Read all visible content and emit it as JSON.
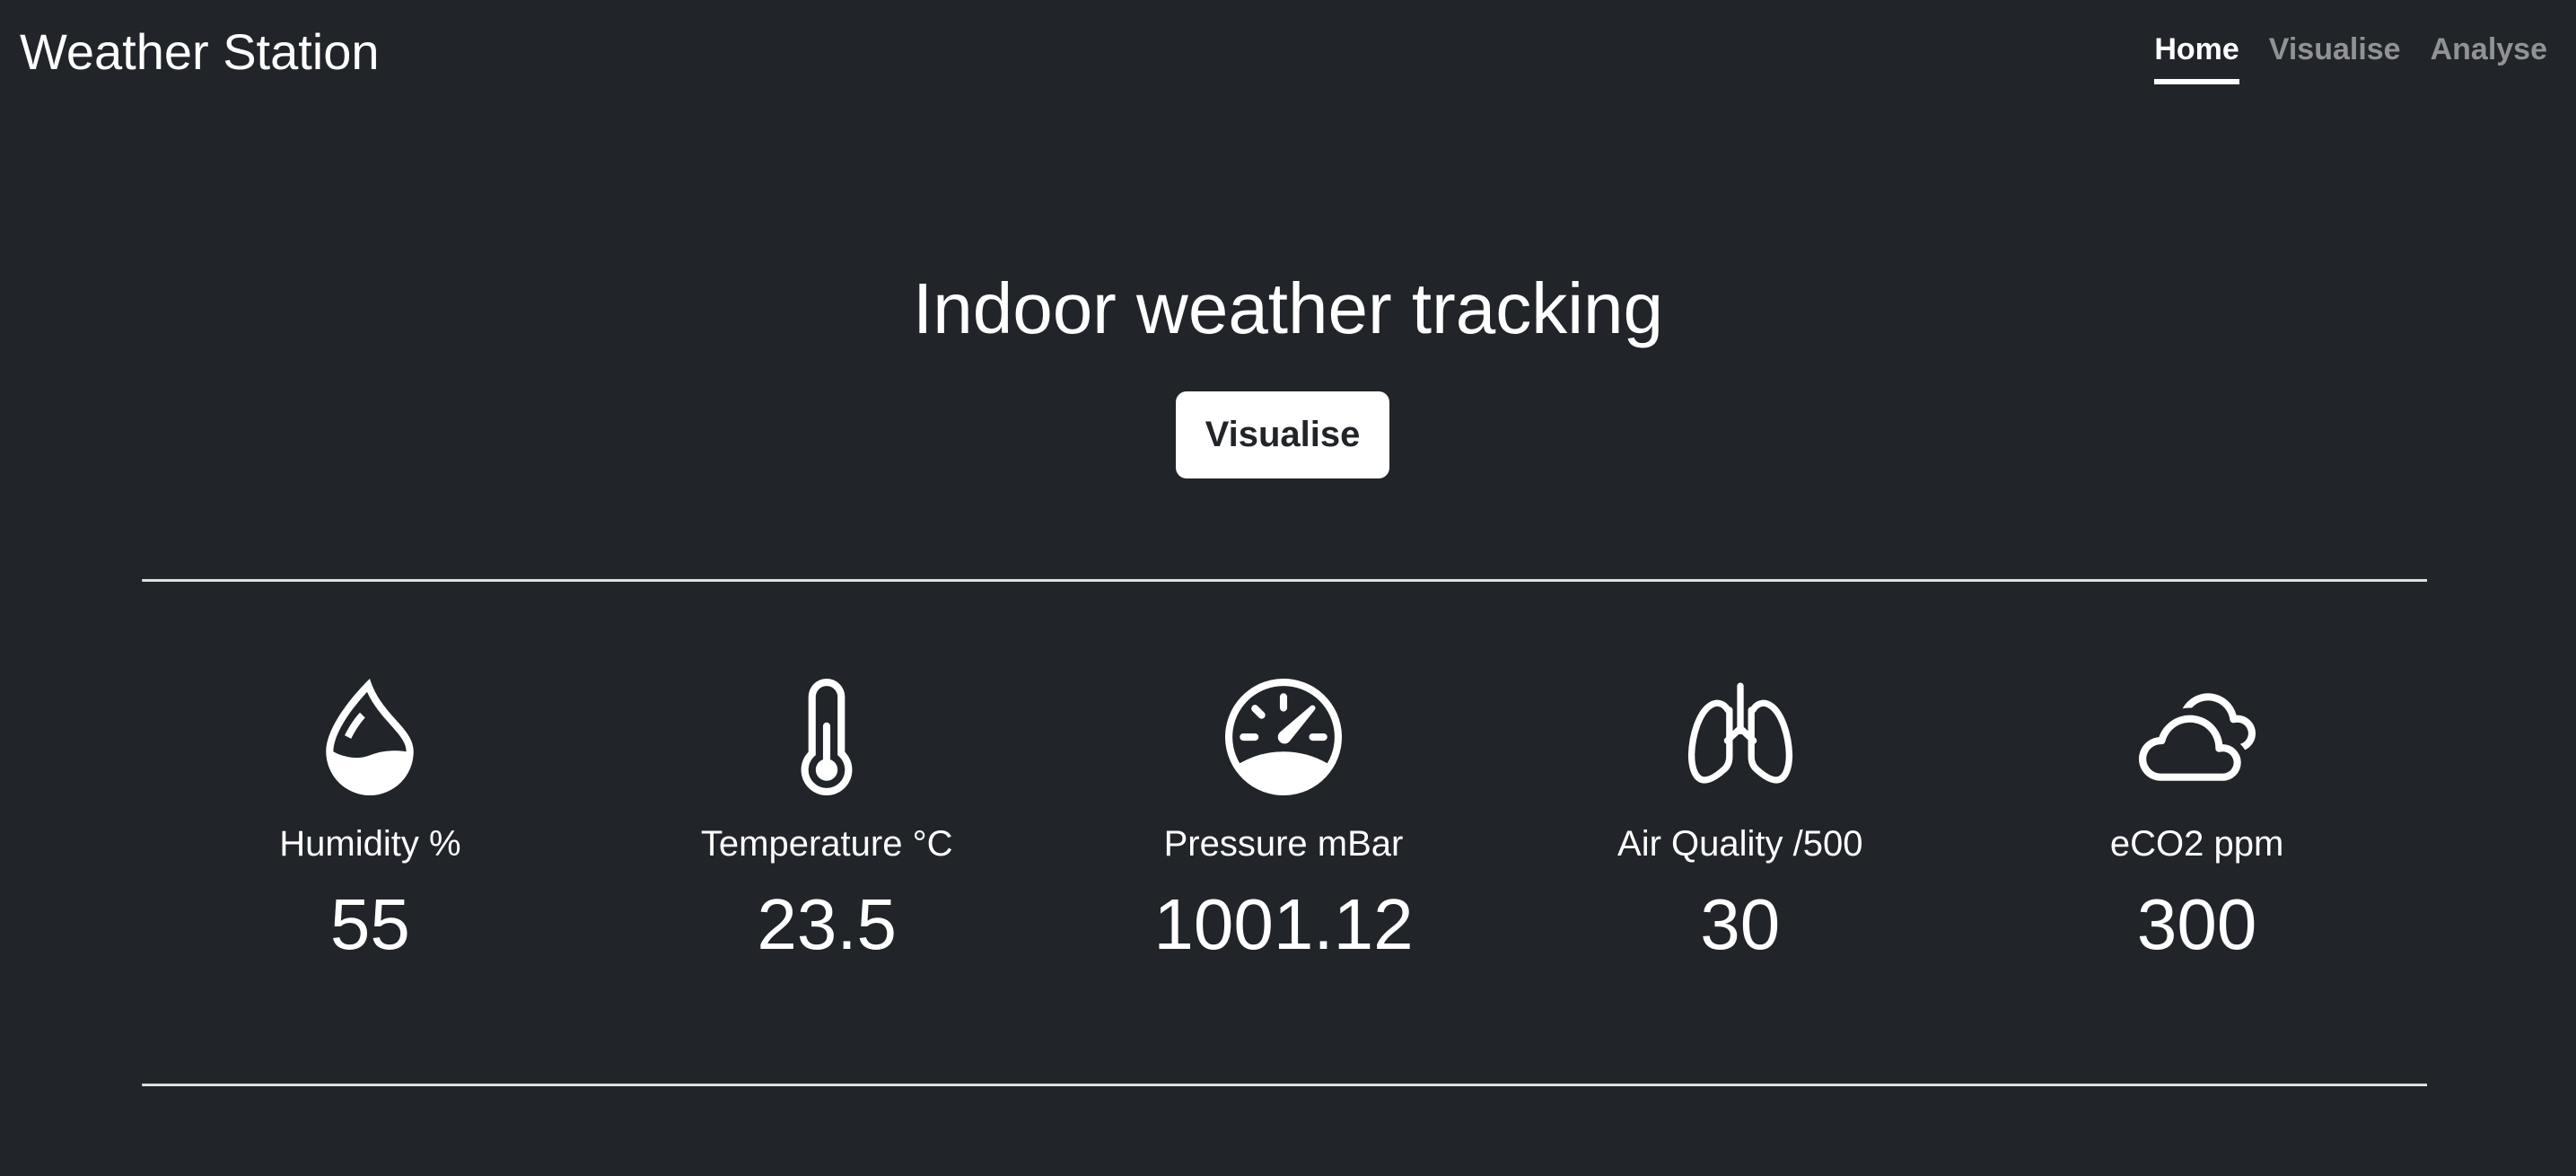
{
  "brand": {
    "title": "Weather Station"
  },
  "nav": {
    "items": [
      {
        "label": "Home",
        "active": true
      },
      {
        "label": "Visualise",
        "active": false
      },
      {
        "label": "Analyse",
        "active": false
      }
    ]
  },
  "hero": {
    "title": "Indoor weather tracking",
    "button_label": "Visualise"
  },
  "stats": [
    {
      "icon": "droplet-half-icon",
      "label": "Humidity %",
      "value": "55"
    },
    {
      "icon": "thermometer-icon",
      "label": "Temperature °C",
      "value": "23.5"
    },
    {
      "icon": "speedometer-icon",
      "label": "Pressure mBar",
      "value": "1001.12"
    },
    {
      "icon": "lungs-icon",
      "label": "Air Quality /500",
      "value": "30"
    },
    {
      "icon": "clouds-icon",
      "label": "eCO2 ppm",
      "value": "300"
    }
  ],
  "colors": {
    "background": "#212529",
    "text": "#ffffff",
    "nav_inactive": "rgba(255,255,255,0.5)",
    "button_background": "#ffffff",
    "button_text": "#212529"
  }
}
